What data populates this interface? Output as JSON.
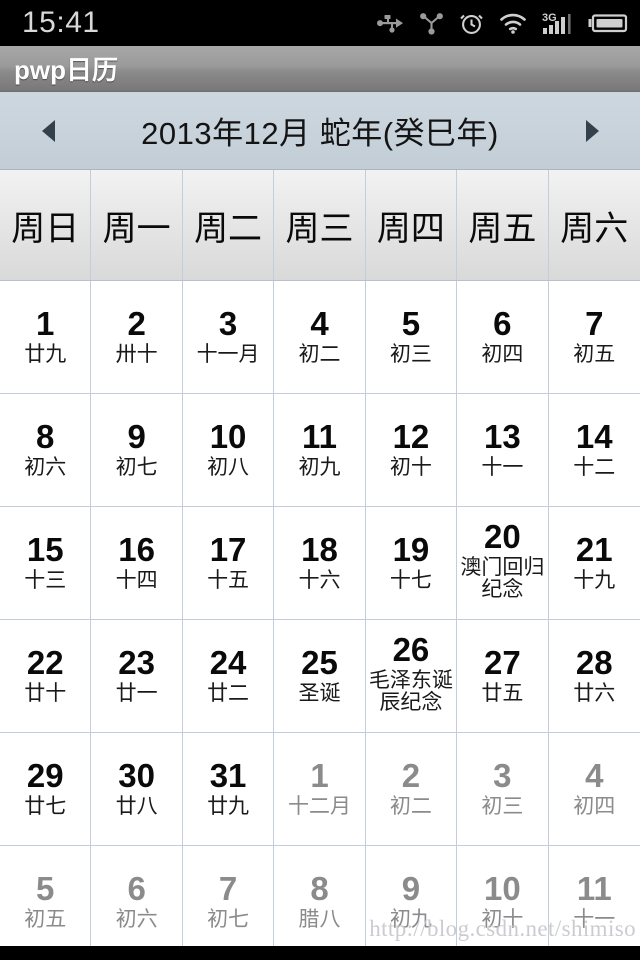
{
  "statusbar": {
    "clock": "15:41",
    "icons": [
      "usb-icon",
      "share-icon",
      "alarm-icon",
      "wifi-icon",
      "signal-3g-icon",
      "battery-icon"
    ],
    "network_label": "3G",
    "background": "#000000"
  },
  "titlebar": {
    "title": "pwp日历"
  },
  "monthnav": {
    "prev_label": "◀",
    "next_label": "▶",
    "month_title": "2013年12月  蛇年(癸巳年)",
    "year": "2013",
    "month": "12",
    "zodiac": "蛇年(癸巳年)"
  },
  "weekdays": [
    "周日",
    "周一",
    "周二",
    "周三",
    "周四",
    "周五",
    "周六"
  ],
  "colors": {
    "current_month_text": "#0a0a0a",
    "other_month_text": "#8b8b8b",
    "grid_border": "#c3cddb",
    "nav_background": "#c8d3dc",
    "header_background": "#e8e8e8"
  },
  "days": [
    {
      "num": "1",
      "sub": "廿九",
      "other": false
    },
    {
      "num": "2",
      "sub": "卅十",
      "other": false
    },
    {
      "num": "3",
      "sub": "十一月",
      "other": false
    },
    {
      "num": "4",
      "sub": "初二",
      "other": false
    },
    {
      "num": "5",
      "sub": "初三",
      "other": false
    },
    {
      "num": "6",
      "sub": "初四",
      "other": false
    },
    {
      "num": "7",
      "sub": "初五",
      "other": false
    },
    {
      "num": "8",
      "sub": "初六",
      "other": false
    },
    {
      "num": "9",
      "sub": "初七",
      "other": false
    },
    {
      "num": "10",
      "sub": "初八",
      "other": false
    },
    {
      "num": "11",
      "sub": "初九",
      "other": false
    },
    {
      "num": "12",
      "sub": "初十",
      "other": false
    },
    {
      "num": "13",
      "sub": "十一",
      "other": false
    },
    {
      "num": "14",
      "sub": "十二",
      "other": false
    },
    {
      "num": "15",
      "sub": "十三",
      "other": false
    },
    {
      "num": "16",
      "sub": "十四",
      "other": false
    },
    {
      "num": "17",
      "sub": "十五",
      "other": false
    },
    {
      "num": "18",
      "sub": "十六",
      "other": false
    },
    {
      "num": "19",
      "sub": "十七",
      "other": false
    },
    {
      "num": "20",
      "sub": "澳门回归纪念",
      "other": false,
      "festival": true
    },
    {
      "num": "21",
      "sub": "十九",
      "other": false
    },
    {
      "num": "22",
      "sub": "廿十",
      "other": false
    },
    {
      "num": "23",
      "sub": "廿一",
      "other": false
    },
    {
      "num": "24",
      "sub": "廿二",
      "other": false
    },
    {
      "num": "25",
      "sub": "圣诞",
      "other": false,
      "festival": true
    },
    {
      "num": "26",
      "sub": "毛泽东诞辰纪念",
      "other": false,
      "festival": true
    },
    {
      "num": "27",
      "sub": "廿五",
      "other": false
    },
    {
      "num": "28",
      "sub": "廿六",
      "other": false
    },
    {
      "num": "29",
      "sub": "廿七",
      "other": false
    },
    {
      "num": "30",
      "sub": "廿八",
      "other": false
    },
    {
      "num": "31",
      "sub": "廿九",
      "other": false
    },
    {
      "num": "1",
      "sub": "十二月",
      "other": true
    },
    {
      "num": "2",
      "sub": "初二",
      "other": true
    },
    {
      "num": "3",
      "sub": "初三",
      "other": true
    },
    {
      "num": "4",
      "sub": "初四",
      "other": true
    },
    {
      "num": "5",
      "sub": "初五",
      "other": true
    },
    {
      "num": "6",
      "sub": "初六",
      "other": true
    },
    {
      "num": "7",
      "sub": "初七",
      "other": true
    },
    {
      "num": "8",
      "sub": "腊八",
      "other": true,
      "festival": true
    },
    {
      "num": "9",
      "sub": "初九",
      "other": true
    },
    {
      "num": "10",
      "sub": "初十",
      "other": true
    },
    {
      "num": "11",
      "sub": "十一",
      "other": true
    }
  ],
  "watermark": {
    "text": "http://blog.csdn.net/shimiso"
  }
}
